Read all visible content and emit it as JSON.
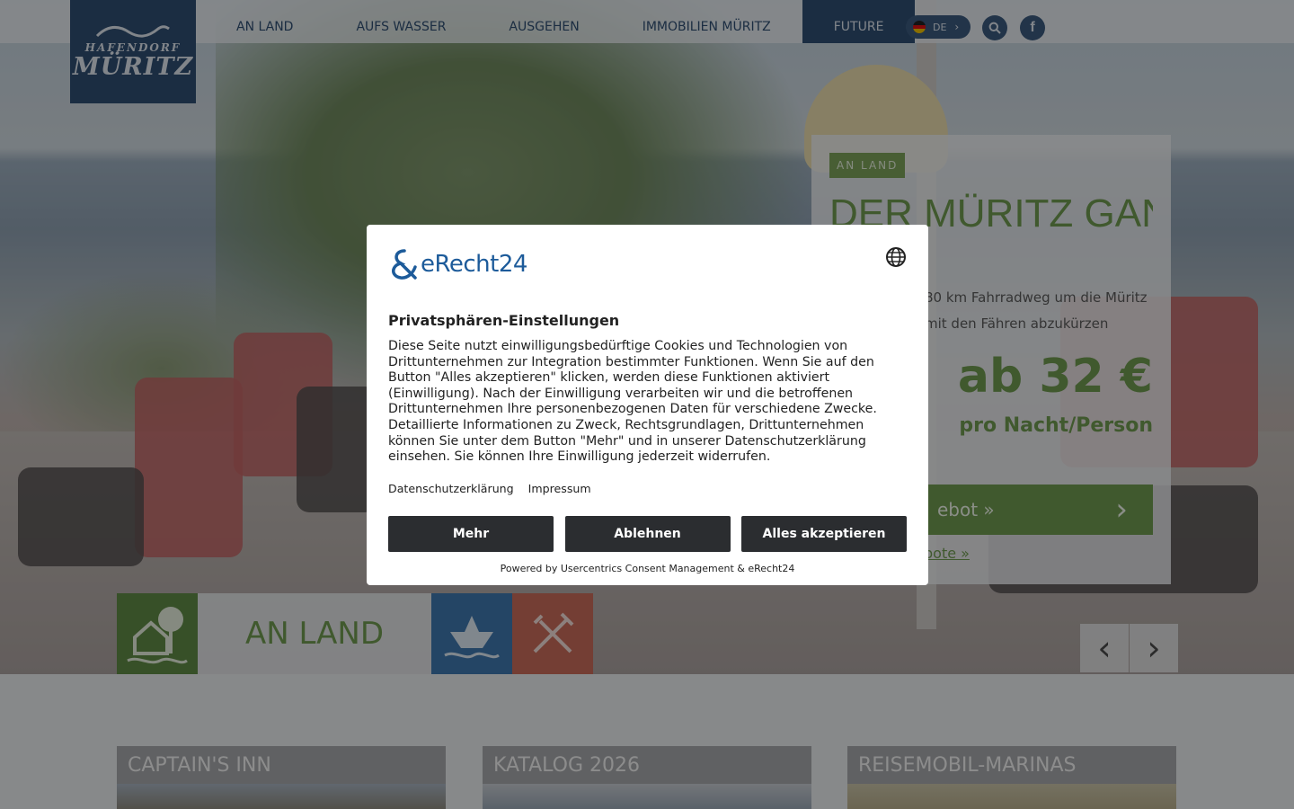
{
  "logo": {
    "line1": "HAFENDORF",
    "line2": "MÜRITZ"
  },
  "nav": [
    {
      "label": "AN LAND"
    },
    {
      "label": "AUFS WASSER"
    },
    {
      "label": "AUSGEHEN"
    },
    {
      "label": "IMMOBILIEN MÜRITZ"
    },
    {
      "label": "FUTURE"
    }
  ],
  "language": {
    "code": "DE"
  },
  "icons": {
    "search": "search-icon",
    "facebook": "facebook-icon",
    "globe": "globe-icon"
  },
  "offer": {
    "category": "AN LAND",
    "title": "DER MÜRITZ GANZ",
    "description_line1": "80 km Fahrradweg um die Müritz",
    "description_line2": "mit den Fähren abzukürzen",
    "price": "ab 32 €",
    "per": "pro Nacht/Person",
    "cta": "ebot »",
    "more": "bote »"
  },
  "category_tab": {
    "label": "AN LAND"
  },
  "cards": [
    {
      "title": "CAPTAIN'S INN"
    },
    {
      "title": "KATALOG 2026"
    },
    {
      "title": "REISEMOBIL-MARINAS"
    }
  ],
  "consent": {
    "brand": "eRecht24",
    "heading": "Privatsphären-Einstellungen",
    "body": "Diese Seite nutzt einwilligungsbedürftige Cookies und Technologien von Drittunternehmen zur Integration bestimmter Funktionen. Wenn Sie auf den Button \"Alles akzeptieren\" klicken, werden diese Funktionen aktiviert (Einwilligung). Nach der Einwilligung verarbeiten wir und die betroffenen Drittunternehmen Ihre personenbezogenen Daten für verschiedene Zwecke. Detaillierte Informationen zu Zweck, Rechtsgrundlagen, Drittunternehmen können Sie unter dem Button \"Mehr\" und in unserer Datenschutzerklärung einsehen. Sie können Ihre Einwilligung jederzeit widerrufen.",
    "link_privacy": "Datenschutzerklärung",
    "link_imprint": "Impressum",
    "btn_more": "Mehr",
    "btn_decline": "Ablehnen",
    "btn_accept": "Alles akzeptieren",
    "powered": "Powered by Usercentrics Consent Management & eRecht24"
  },
  "colors": {
    "navy": "#2f4e72",
    "green": "#6f9a50",
    "water_blue": "#3f78ae",
    "eat_red": "#c96b5b",
    "dialog_button": "#2b2d30"
  }
}
